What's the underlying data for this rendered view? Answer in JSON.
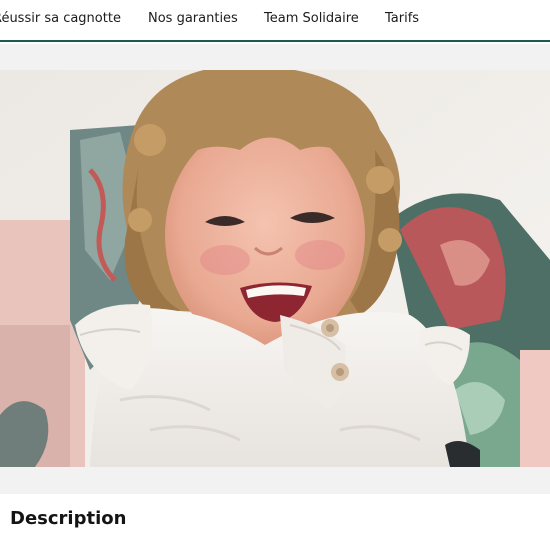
{
  "nav": {
    "items": [
      {
        "label": "Réussir sa cagnotte"
      },
      {
        "label": "Nos garanties"
      },
      {
        "label": "Team Solidaire"
      },
      {
        "label": "Tarifs"
      }
    ]
  },
  "photo": {
    "icon": "photo-of-smiling-toddler"
  },
  "section": {
    "title": "Description"
  },
  "colors": {
    "nav_underline": "#1f5a4f",
    "band_background": "#f2f2f2"
  }
}
